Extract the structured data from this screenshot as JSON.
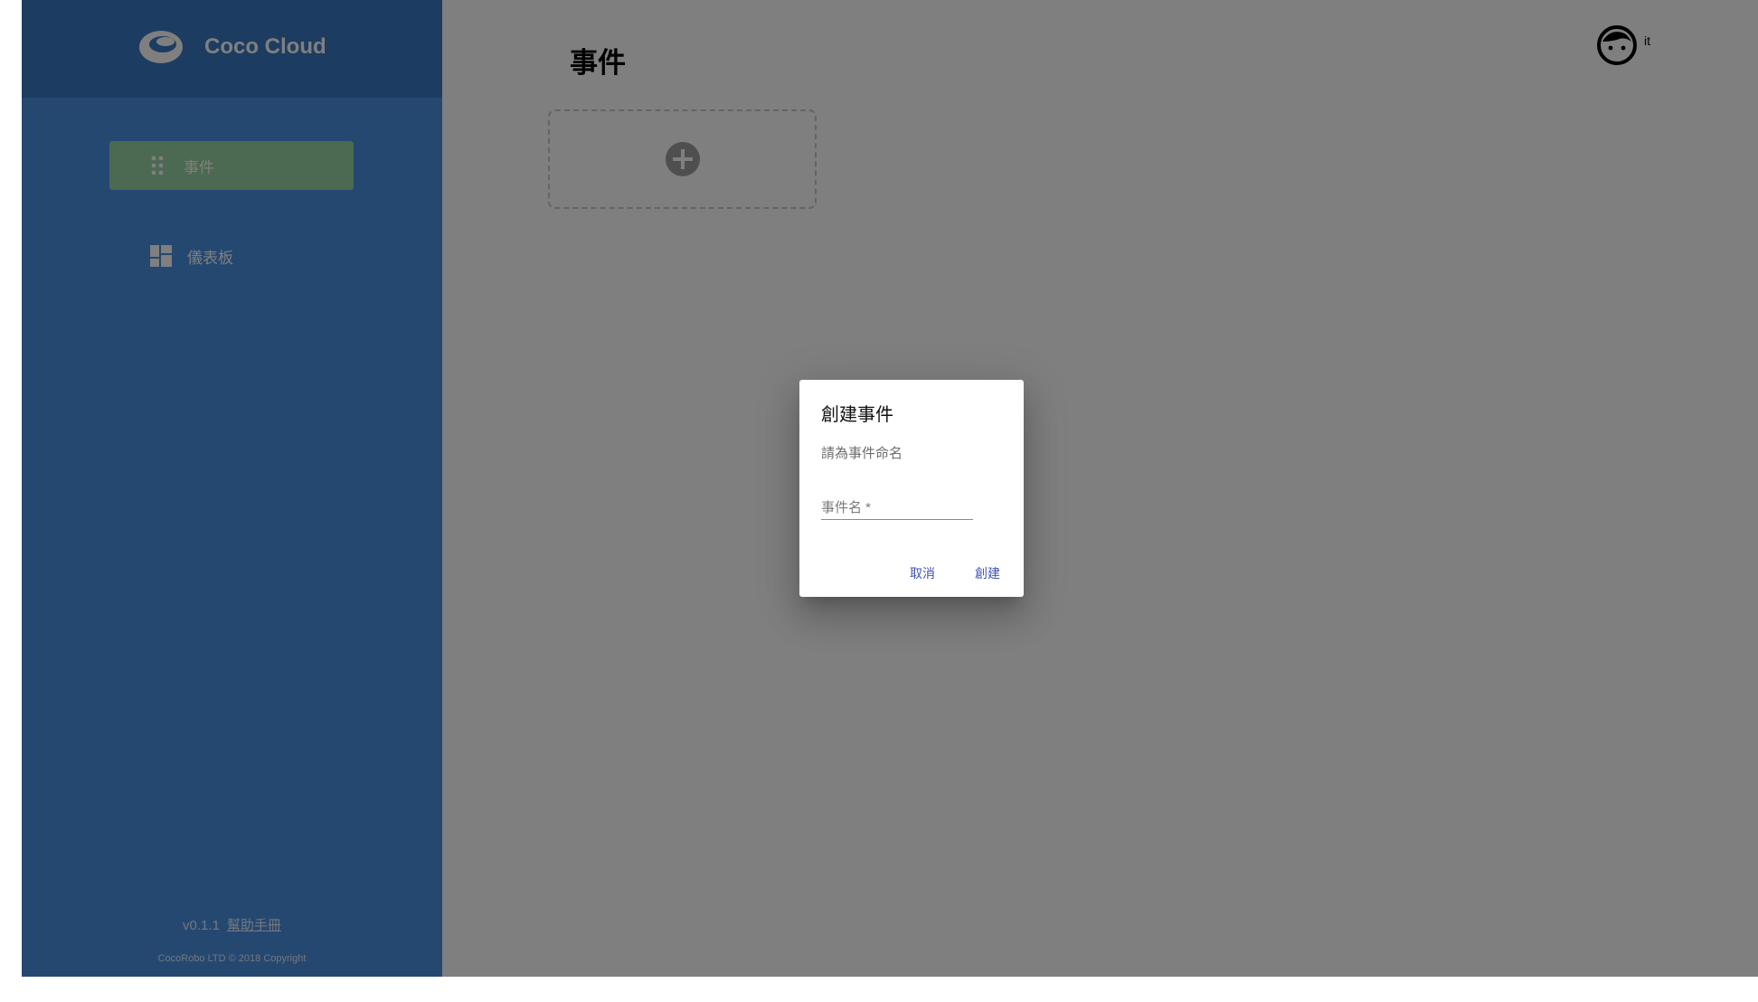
{
  "app": {
    "brand": "Coco Cloud"
  },
  "sidebar": {
    "items": [
      {
        "label": "事件",
        "icon": "drag-dots-icon",
        "active": true
      },
      {
        "label": "儀表板",
        "icon": "dashboard-icon",
        "active": false
      }
    ],
    "footer": {
      "version": "v0.1.1",
      "help_link": "幫助手冊",
      "copyright": "CocoRobo LTD © 2018 Copyright"
    }
  },
  "main": {
    "title": "事件",
    "add_card_icon": "add-circle-icon"
  },
  "user": {
    "name": "it",
    "avatar_icon": "face-avatar-icon"
  },
  "dialog": {
    "title": "創建事件",
    "description": "請為事件命名",
    "field_placeholder": "事件名 *",
    "field_value": "",
    "cancel_label": "取消",
    "create_label": "創建"
  },
  "colors": {
    "sidebar": "#4b90e2",
    "sidebar_header": "#3a79c3",
    "active_item": "#98d3a5",
    "accent": "#3f51b5",
    "overlay": "rgba(0,0,0,0.5)"
  }
}
